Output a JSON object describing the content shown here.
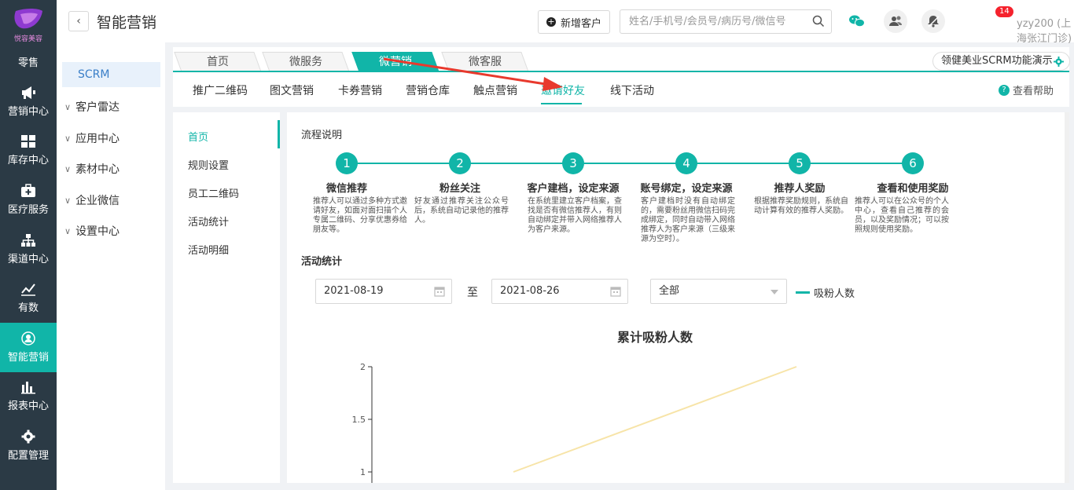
{
  "brand": {
    "logo_text": "悦容美容"
  },
  "left_nav": [
    {
      "label": "零售",
      "icon": "retail-icon"
    },
    {
      "label": "营销中心",
      "icon": "megaphone-icon"
    },
    {
      "label": "库存中心",
      "icon": "grid-icon"
    },
    {
      "label": "医疗服务",
      "icon": "medical-kit-icon"
    },
    {
      "label": "渠道中心",
      "icon": "org-chart-icon"
    },
    {
      "label": "有数",
      "icon": "trend-line-icon"
    },
    {
      "label": "智能营销",
      "icon": "smart-marketing-icon",
      "active": true
    },
    {
      "label": "报表中心",
      "icon": "bar-chart-icon"
    },
    {
      "label": "配置管理",
      "icon": "gear-icon"
    }
  ],
  "header": {
    "title": "智能营销",
    "new_customer_label": "新增客户",
    "search_placeholder": "姓名/手机号/会员号/病历号/微信号",
    "notification_count": "14",
    "user_label": "yzy200 (上海张江门诊)"
  },
  "sidebar2": {
    "active": "SCRM",
    "items": [
      "客户雷达",
      "应用中心",
      "素材中心",
      "企业微信",
      "设置中心"
    ]
  },
  "tabs": [
    {
      "label": "首页"
    },
    {
      "label": "微服务"
    },
    {
      "label": "微营销",
      "active": true
    },
    {
      "label": "微客服"
    }
  ],
  "demo_button": "领健美业SCRM功能演示",
  "subnav": {
    "items": [
      "推广二维码",
      "图文营销",
      "卡券营销",
      "营销仓库",
      "触点营销",
      "邀请好友",
      "线下活动"
    ],
    "active_index": 5,
    "help_label": "查看帮助"
  },
  "left_menu": {
    "items": [
      "首页",
      "规则设置",
      "员工二维码",
      "活动统计",
      "活动明细"
    ],
    "active_index": 0
  },
  "flow": {
    "section_title": "流程说明",
    "steps": [
      {
        "num": "1",
        "title": "微信推荐",
        "desc": "推荐人可以通过多种方式邀请好友，如面对面扫描个人专属二维码、分享优惠券给朋友等。"
      },
      {
        "num": "2",
        "title": "粉丝关注",
        "desc": "好友通过推荐关注公众号后，系统自动记录他的推荐人。"
      },
      {
        "num": "3",
        "title": "客户建档，设定来源",
        "desc": "在系统里建立客户档案，查找是否有微信推荐人，有则自动绑定并带入网络推荐人为客户来源。"
      },
      {
        "num": "4",
        "title": "账号绑定，设定来源",
        "desc": "客户建档时没有自动绑定的，需要粉丝用微信扫码完成绑定，同时自动带入网络推荐人为客户来源（三级来源为空时）。"
      },
      {
        "num": "5",
        "title": "推荐人奖励",
        "desc": "根据推荐奖励规则，系统自动计算有效的推荐人奖励。"
      },
      {
        "num": "6",
        "title": "查看和使用奖励",
        "desc": "推荐人可以在公众号的个人中心，查看自己推荐的会员，以及奖励情况；可以按照规则使用奖励。"
      }
    ]
  },
  "stats": {
    "section_title": "活动统计",
    "date_from": "2021-08-19",
    "to_label": "至",
    "date_to": "2021-08-26",
    "filter_value": "全部"
  },
  "chart_data": {
    "type": "line",
    "title": "累计吸粉人数",
    "series": [
      {
        "name": "吸粉人数",
        "values": [
          1,
          2
        ],
        "color": "#f7e4a8"
      }
    ],
    "yticks": [
      "2",
      "1.5",
      "1"
    ],
    "ylim": [
      1,
      2
    ],
    "grid": false,
    "legend": "top"
  },
  "colors": {
    "accent": "#11b5a8",
    "sidebar_bg": "#2b3a45",
    "arrow": "#e8392d",
    "badge": "#f5222d"
  }
}
